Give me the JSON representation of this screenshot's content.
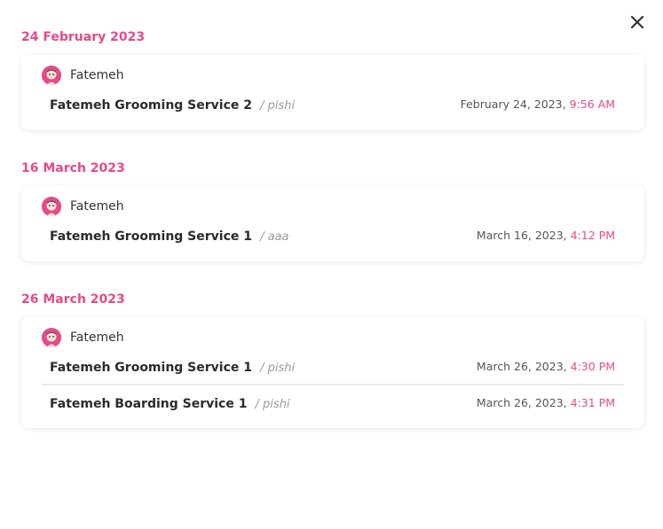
{
  "close_icon": "close-icon",
  "accent_color": "#e64a8a",
  "groups": [
    {
      "date": "24 February 2023",
      "owner": "Fatemeh",
      "entries": [
        {
          "service": "Fatemeh Grooming Service 2",
          "sub": "/ pishi",
          "date": "February 24, 2023,",
          "time": "9:56 AM"
        }
      ]
    },
    {
      "date": "16 March 2023",
      "owner": "Fatemeh",
      "entries": [
        {
          "service": "Fatemeh Grooming Service 1",
          "sub": "/ aaa",
          "date": "March 16, 2023,",
          "time": "4:12 PM"
        }
      ]
    },
    {
      "date": "26 March 2023",
      "owner": "Fatemeh",
      "entries": [
        {
          "service": "Fatemeh Grooming Service 1",
          "sub": "/ pishi",
          "date": "March 26, 2023,",
          "time": "4:30 PM"
        },
        {
          "service": "Fatemeh Boarding Service 1",
          "sub": "/ pishi",
          "date": "March 26, 2023,",
          "time": "4:31 PM"
        }
      ]
    }
  ]
}
